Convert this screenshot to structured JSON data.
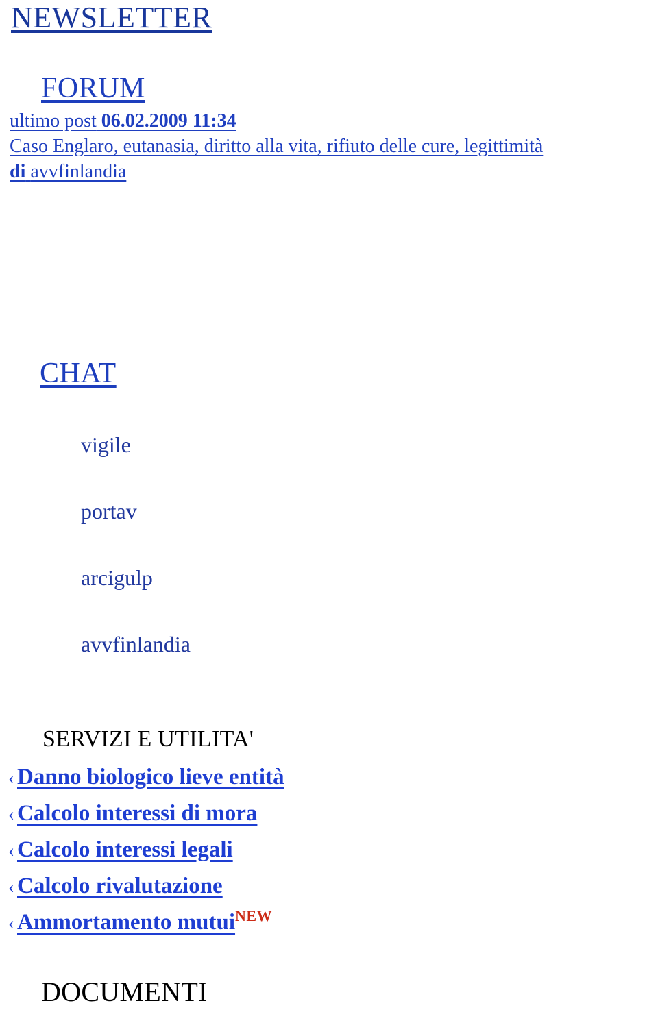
{
  "colors": {
    "link_blue": "#1f3fc0",
    "heading_blue": "#1d3ebd",
    "chat_blue": "#21389e",
    "service_blue": "#1e3ed2",
    "new_badge_red": "#cc2b16",
    "black": "#000000",
    "background": "#ffffff"
  },
  "newsletter": {
    "title": "NEWSLETTER"
  },
  "forum": {
    "title": "FORUM",
    "last_post_label": "ultimo post",
    "last_post_datetime": "06.02.2009 11:34",
    "thread_title": "Caso Englaro, eutanasia, diritto alla vita, rifiuto delle cure, legittimità",
    "author_prefix": "di",
    "author": "avvfinlandia"
  },
  "chat": {
    "title": "CHAT",
    "users": [
      {
        "name": "vigile"
      },
      {
        "name": "portav"
      },
      {
        "name": "arcigulp"
      },
      {
        "name": "avvfinlandia"
      }
    ]
  },
  "servizi": {
    "title": "SERVIZI E UTILITA'",
    "bullet": "‹",
    "items": [
      {
        "label": "Danno biologico lieve entità",
        "badge": ""
      },
      {
        "label": "Calcolo interessi di mora",
        "badge": ""
      },
      {
        "label": "Calcolo interessi legali",
        "badge": ""
      },
      {
        "label": "Calcolo rivalutazione",
        "badge": ""
      },
      {
        "label": "Ammortamento mutui",
        "badge": "NEW"
      }
    ]
  },
  "documenti": {
    "title": "DOCUMENTI"
  }
}
